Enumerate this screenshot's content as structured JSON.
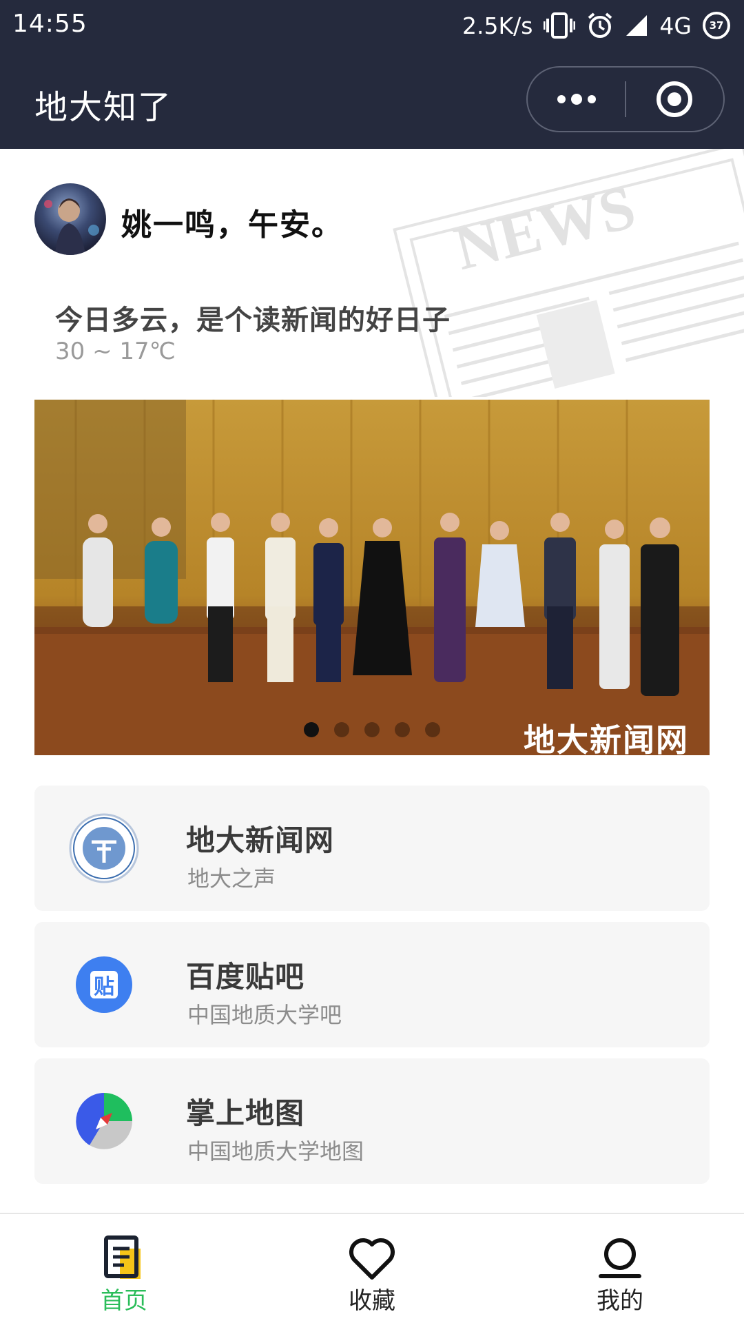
{
  "status_bar": {
    "time": "14:55",
    "net_speed": "2.5K/s",
    "network": "4G",
    "battery": "37"
  },
  "nav": {
    "title": "地大知了"
  },
  "header": {
    "greeting": "姚一鸣，午安。",
    "weather_title": "今日多云，是个读新闻的好日子",
    "weather_temp": "30 ~ 17℃",
    "news_bg_text": "NEWS"
  },
  "banner": {
    "watermark": "地大新闻网",
    "dots": 5,
    "active_dot": 0
  },
  "cards": [
    {
      "title": "地大新闻网",
      "subtitle": "地大之声",
      "icon": "university-seal-icon"
    },
    {
      "title": "百度贴吧",
      "subtitle": "中国地质大学吧",
      "icon": "tieba-icon",
      "icon_text": "贴"
    },
    {
      "title": "掌上地图",
      "subtitle": "中国地质大学地图",
      "icon": "map-compass-icon"
    }
  ],
  "tabs": [
    {
      "label": "首页",
      "icon": "home-doc-icon",
      "active": true
    },
    {
      "label": "收藏",
      "icon": "heart-icon",
      "active": false
    },
    {
      "label": "我的",
      "icon": "user-icon",
      "active": false
    }
  ],
  "colors": {
    "nav_bg": "#252a3d",
    "accent_green": "#2bbd5a",
    "tieba_blue": "#3e7ff0",
    "card_bg": "#f6f6f6"
  }
}
